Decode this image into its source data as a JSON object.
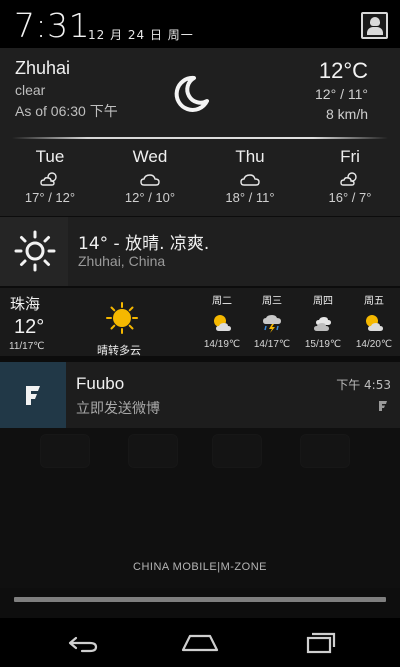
{
  "status": {
    "time": "7:31",
    "date": "12 月 24 日 周一"
  },
  "weather": {
    "city": "Zhuhai",
    "condition": "clear",
    "as_of": "As of 06:30 下午",
    "temp": "12°C",
    "hilo": "12° / 11°",
    "wind": "8 km/h",
    "forecast": [
      {
        "day": "Tue",
        "range": "17° / 12°",
        "icon": "partly-cloudy-icon"
      },
      {
        "day": "Wed",
        "range": "12° / 10°",
        "icon": "cloudy-icon"
      },
      {
        "day": "Thu",
        "range": "18° / 11°",
        "icon": "cloudy-icon"
      },
      {
        "day": "Fri",
        "range": "16° / 7°",
        "icon": "partly-cloudy-icon"
      }
    ]
  },
  "summary": {
    "line1": "14° - 放晴. 凉爽.",
    "line2": "Zhuhai, China"
  },
  "cn_weather": {
    "city": "珠海",
    "temp": "12°",
    "range": "11/17℃",
    "condition": "晴转多云",
    "days": [
      {
        "name": "周二",
        "range": "14/19℃",
        "icon": "partly-sunny-icon"
      },
      {
        "name": "周三",
        "range": "14/17℃",
        "icon": "thunderstorm-icon"
      },
      {
        "name": "周四",
        "range": "15/19℃",
        "icon": "cloudy-icon"
      },
      {
        "name": "周五",
        "range": "14/20℃",
        "icon": "partly-sunny-icon"
      }
    ]
  },
  "notification": {
    "title": "Fuubo",
    "text": "立即发送微博",
    "time": "下午 4:53"
  },
  "carrier": "CHINA  MOBILE|M-ZONE",
  "colors": {
    "notification_icon_bg": "#213847",
    "sun_yellow": "#f5b800"
  }
}
